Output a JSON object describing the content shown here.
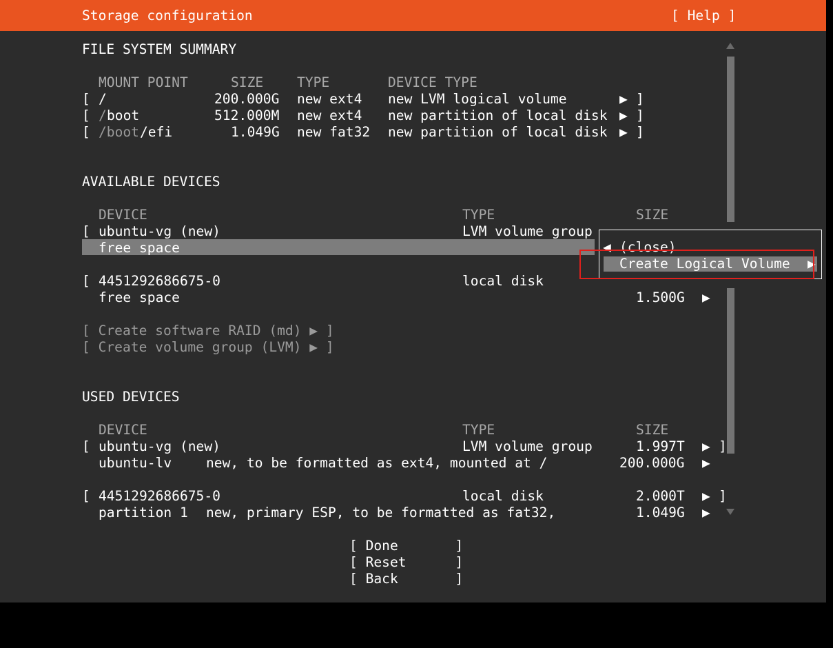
{
  "header": {
    "title": "Storage configuration",
    "help": "[ Help ]"
  },
  "fs_summary": {
    "section_title": "FILE SYSTEM SUMMARY",
    "columns": {
      "mount": "MOUNT POINT",
      "size": "SIZE",
      "type": "TYPE",
      "device_type": "DEVICE TYPE"
    },
    "rows": [
      {
        "lb": "[",
        "mount_dim": "",
        "mount": "/",
        "size": "200.000G",
        "type": "new ext4",
        "device_type": "new LVM logical volume",
        "arrow": "▶",
        "rb": "]"
      },
      {
        "lb": "[",
        "mount_dim": "/",
        "mount": "boot",
        "size": "512.000M",
        "type": "new ext4",
        "device_type": "new partition of local disk",
        "arrow": "▶",
        "rb": "]"
      },
      {
        "lb": "[",
        "mount_dim": "/boot",
        "mount": "/efi",
        "size": "1.049G",
        "type": "new fat32",
        "device_type": "new partition of local disk",
        "arrow": "▶",
        "rb": "]"
      }
    ]
  },
  "available": {
    "section_title": "AVAILABLE DEVICES",
    "columns": {
      "device": "DEVICE",
      "type": "TYPE",
      "size": "SIZE"
    },
    "vg": {
      "lb": "[",
      "name": "ubuntu-vg (new)",
      "type": "LVM volume group"
    },
    "vg_free": {
      "name": "free space"
    },
    "disk": {
      "lb": "[",
      "name": "4451292686675-0",
      "type": "local disk"
    },
    "disk_free": {
      "name": "free space",
      "size": "1.500G",
      "arrow": "▶"
    },
    "actions": {
      "raid": "[ Create software RAID (md) ▶ ]",
      "lvm": "[ Create volume group (LVM) ▶ ]"
    }
  },
  "popup": {
    "close_arrow": "◀",
    "close": "(close)",
    "create_lv": "Create Logical Volume",
    "create_lv_arrow": "▶"
  },
  "used": {
    "section_title": "USED DEVICES",
    "columns": {
      "device": "DEVICE",
      "type": "TYPE",
      "size": "SIZE"
    },
    "vg": {
      "lb": "[",
      "name": "ubuntu-vg (new)",
      "type": "LVM volume group",
      "size": "1.997T",
      "arrow": "▶",
      "rb": "]"
    },
    "lv": {
      "name": "ubuntu-lv",
      "desc": "new, to be formatted as ext4, mounted at /",
      "size": "200.000G",
      "arrow": "▶"
    },
    "disk": {
      "lb": "[",
      "name": "4451292686675-0",
      "type": "local disk",
      "size": "2.000T",
      "arrow": "▶",
      "rb": "]"
    },
    "part": {
      "name": "partition 1",
      "desc": "new, primary ESP, to be formatted as fat32,",
      "size": "1.049G",
      "arrow": "▶"
    }
  },
  "buttons": {
    "done": "[ Done       ]",
    "reset": "[ Reset      ]",
    "back": "[ Back       ]"
  },
  "colors": {
    "header": "#e95420",
    "background": "#2c2c2c",
    "highlight": "#7d7d7d",
    "annotation": "#e0201c"
  }
}
